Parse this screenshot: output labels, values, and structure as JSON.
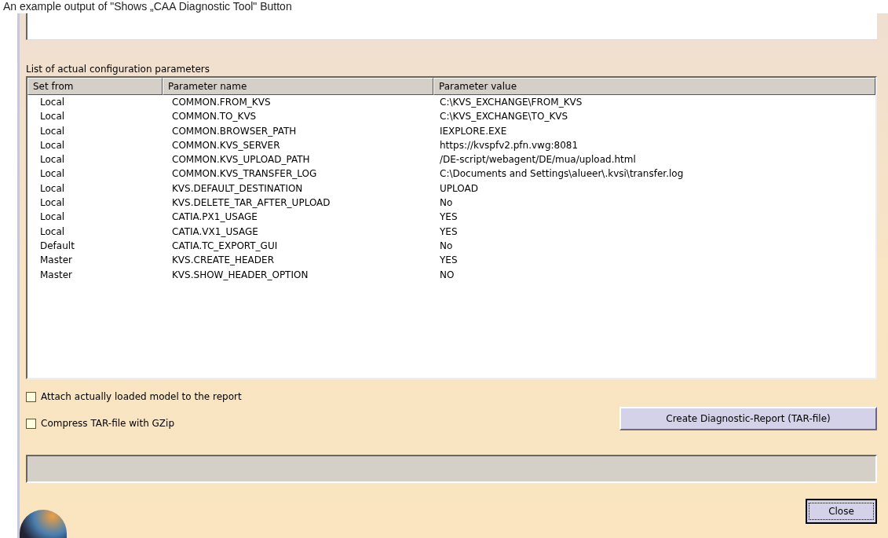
{
  "caption": "An example output of \"Shows „CAA Diagnostic Tool\" Button",
  "parameters_label": "List of actual configuration parameters",
  "table": {
    "columns": [
      "Set from",
      "Parameter name",
      "Parameter value"
    ],
    "rows": [
      [
        "Local",
        "COMMON.FROM_KVS",
        "C:\\KVS_EXCHANGE\\FROM_KVS"
      ],
      [
        "Local",
        "COMMON.TO_KVS",
        "C:\\KVS_EXCHANGE\\TO_KVS"
      ],
      [
        "Local",
        "COMMON.BROWSER_PATH",
        "IEXPLORE.EXE"
      ],
      [
        "Local",
        "COMMON.KVS_SERVER",
        "https://kvspfv2.pfn.vwg:8081"
      ],
      [
        "Local",
        "COMMON.KVS_UPLOAD_PATH",
        "/DE-script/webagent/DE/mua/upload.html"
      ],
      [
        "Local",
        "COMMON.KVS_TRANSFER_LOG",
        "C:\\Documents and Settings\\alueer\\.kvsi\\transfer.log"
      ],
      [
        "Local",
        "KVS.DEFAULT_DESTINATION",
        "UPLOAD"
      ],
      [
        "Local",
        "KVS.DELETE_TAR_AFTER_UPLOAD",
        "No"
      ],
      [
        "Local",
        "CATIA.PX1_USAGE",
        "YES"
      ],
      [
        "Local",
        "CATIA.VX1_USAGE",
        "YES"
      ],
      [
        "Default",
        "CATIA.TC_EXPORT_GUI",
        "No"
      ],
      [
        "Master",
        "KVS.CREATE_HEADER",
        "YES"
      ],
      [
        "Master",
        "KVS.SHOW_HEADER_OPTION",
        "NO"
      ]
    ]
  },
  "options": [
    {
      "label": "Attach actually loaded model to the report",
      "checked": false
    },
    {
      "label": "Compress TAR-file with GZip",
      "checked": false
    }
  ],
  "create_button": "Create Diagnostic-Report (TAR-file)",
  "progress": {
    "level": 0
  },
  "close_button": "Close"
}
